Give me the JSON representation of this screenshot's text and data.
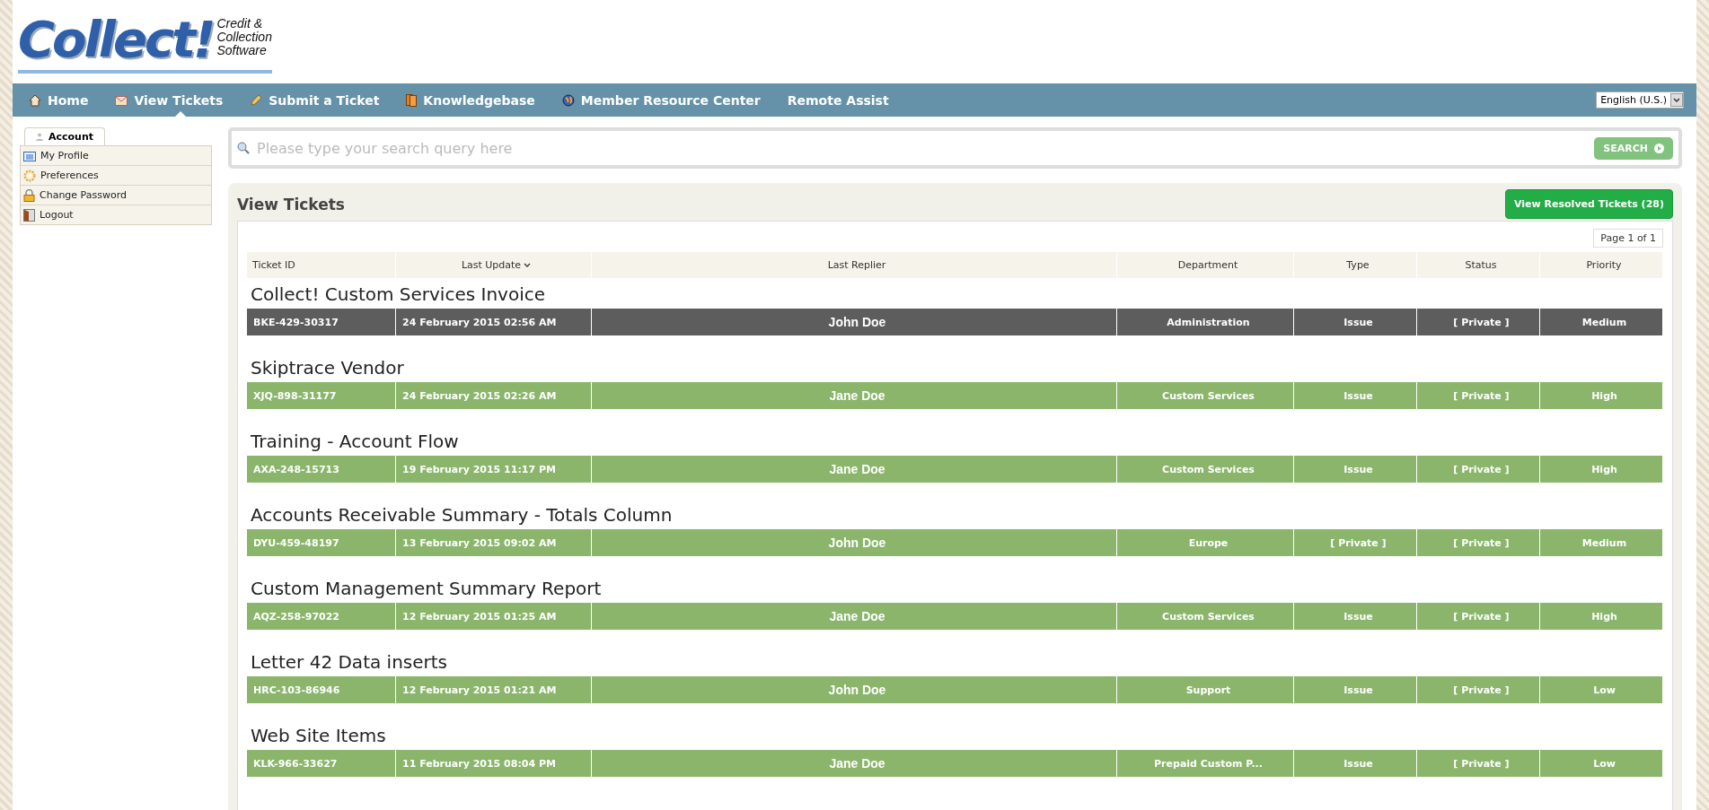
{
  "logo": {
    "wordmark": "Collect!",
    "tagline": [
      "Credit &",
      "Collection",
      "Software"
    ]
  },
  "nav": {
    "items": [
      {
        "label": "Home",
        "selected": false
      },
      {
        "label": "View Tickets",
        "selected": true
      },
      {
        "label": "Submit a Ticket",
        "selected": false
      },
      {
        "label": "Knowledgebase",
        "selected": false
      },
      {
        "label": "Member Resource Center",
        "selected": false
      },
      {
        "label": "Remote Assist",
        "selected": false
      }
    ],
    "language": "English (U.S.)"
  },
  "sidebar": {
    "tab": "Account",
    "items": [
      "My Profile",
      "Preferences",
      "Change Password",
      "Logout"
    ]
  },
  "search": {
    "placeholder": "Please type your search query here",
    "button": "SEARCH"
  },
  "panel": {
    "title": "View Tickets",
    "resolved_button": "View Resolved Tickets (28)",
    "pagination": "Page 1 of 1"
  },
  "table": {
    "columns": [
      {
        "label": "Ticket ID",
        "sorted": false
      },
      {
        "label": "Last Update",
        "sorted": true
      },
      {
        "label": "Last Replier",
        "sorted": false
      },
      {
        "label": "Department",
        "sorted": false
      },
      {
        "label": "Type",
        "sorted": false
      },
      {
        "label": "Status",
        "sorted": false
      },
      {
        "label": "Priority",
        "sorted": false
      }
    ],
    "tickets": [
      {
        "subject": "Collect! Custom Services Invoice",
        "selected": true,
        "cells": [
          "BKE-429-30317",
          "24 February 2015 02:56 AM",
          "John Doe",
          "Administration",
          "Issue",
          "[ Private ]",
          "Medium"
        ]
      },
      {
        "subject": "Skiptrace Vendor",
        "selected": false,
        "cells": [
          "XJQ-898-31177",
          "24 February 2015 02:26 AM",
          "Jane Doe",
          "Custom Services",
          "Issue",
          "[ Private ]",
          "High"
        ]
      },
      {
        "subject": "Training - Account Flow",
        "selected": false,
        "cells": [
          "AXA-248-15713",
          "19 February 2015 11:17 PM",
          "Jane Doe",
          "Custom Services",
          "Issue",
          "[ Private ]",
          "High"
        ]
      },
      {
        "subject": "Accounts Receivable Summary - Totals Column",
        "selected": false,
        "cells": [
          "DYU-459-48197",
          "13 February 2015 09:02 AM",
          "John Doe",
          "Europe",
          "[ Private ]",
          "[ Private ]",
          "Medium"
        ]
      },
      {
        "subject": "Custom Management Summary Report",
        "selected": false,
        "cells": [
          "AQZ-258-97022",
          "12 February 2015 01:25 AM",
          "Jane Doe",
          "Custom Services",
          "Issue",
          "[ Private ]",
          "High"
        ]
      },
      {
        "subject": "Letter 42 Data inserts",
        "selected": false,
        "cells": [
          "HRC-103-86946",
          "12 February 2015 01:21 AM",
          "John Doe",
          "Support",
          "Issue",
          "[ Private ]",
          "Low"
        ]
      },
      {
        "subject": "Web Site Items",
        "selected": false,
        "cells": [
          "KLK-966-33627",
          "11 February 2015 08:04 PM",
          "Jane Doe",
          "Prepaid Custom P...",
          "Issue",
          "[ Private ]",
          "Low"
        ]
      }
    ]
  }
}
